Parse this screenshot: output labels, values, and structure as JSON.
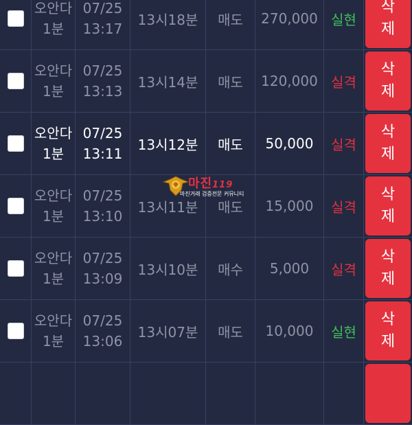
{
  "rows": [
    {
      "game_line1": "오안다",
      "game_line2": "1분",
      "date": "07/25",
      "time": "13:17",
      "round": "13시18분",
      "type": "매도",
      "amount": "270,000",
      "result": "실현",
      "result_status": "win",
      "delete_line1": "삭",
      "delete_line2": "제"
    },
    {
      "game_line1": "오안다",
      "game_line2": "1분",
      "date": "07/25",
      "time": "13:13",
      "round": "13시14분",
      "type": "매도",
      "amount": "120,000",
      "result": "실격",
      "result_status": "lose",
      "delete_line1": "삭",
      "delete_line2": "제"
    },
    {
      "game_line1": "오안다",
      "game_line2": "1분",
      "date": "07/25",
      "time": "13:11",
      "round": "13시12분",
      "type": "매도",
      "amount": "50,000",
      "result": "실격",
      "result_status": "lose",
      "delete_line1": "삭",
      "delete_line2": "제"
    },
    {
      "game_line1": "오안다",
      "game_line2": "1분",
      "date": "07/25",
      "time": "13:10",
      "round": "13시11분",
      "type": "매도",
      "amount": "15,000",
      "result": "실격",
      "result_status": "lose",
      "delete_line1": "삭",
      "delete_line2": "제"
    },
    {
      "game_line1": "오안다",
      "game_line2": "1분",
      "date": "07/25",
      "time": "13:09",
      "round": "13시10분",
      "type": "매수",
      "amount": "5,000",
      "result": "실격",
      "result_status": "lose",
      "delete_line1": "삭",
      "delete_line2": "제"
    },
    {
      "game_line1": "오안다",
      "game_line2": "1분",
      "date": "07/25",
      "time": "13:06",
      "round": "13시07분",
      "type": "매도",
      "amount": "10,000",
      "result": "실현",
      "result_status": "win",
      "delete_line1": "삭",
      "delete_line2": "제"
    }
  ],
  "watermark": {
    "title": "마진",
    "suffix": "119",
    "subtitle": "마진거래 검증전문 커뮤니티"
  },
  "colors": {
    "background": "#232941",
    "win": "#3fbf5a",
    "lose": "#e0323f",
    "delete_button": "#e5323f"
  }
}
